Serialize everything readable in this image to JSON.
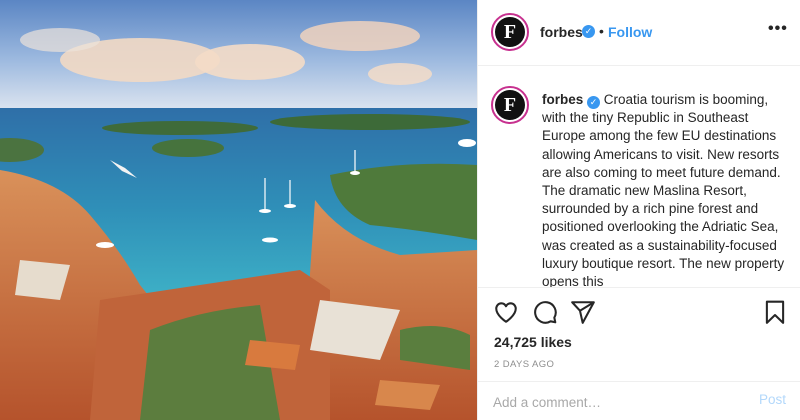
{
  "header": {
    "avatar_letter": "F",
    "username": "forbes",
    "verified_icon": "verified-badge-icon",
    "separator": "•",
    "follow_label": "Follow",
    "more_label": "•••"
  },
  "caption": {
    "avatar_letter": "F",
    "username": "forbes",
    "text": "Croatia tourism is booming, with the tiny Republic in Southeast Europe among the few EU destinations allowing Americans to visit. New resorts are also coming to meet future demand. The dramatic new Maslina Resort, surrounded by a rich pine forest and positioned overlooking the Adriatic Sea, was created as a sustainability-focused luxury boutique resort. The new property opens this"
  },
  "actions": {
    "icons": [
      "heart-icon",
      "comment-icon",
      "share-icon",
      "bookmark-icon"
    ],
    "likes": "24,725 likes",
    "time": "2 DAYS AGO"
  },
  "comment": {
    "placeholder": "Add a comment…",
    "post_label": "Post"
  },
  "colors": {
    "accent": "#3897f0",
    "post_disabled": "#b3d8fb",
    "avatar_ring": "#c7318f",
    "muted": "#8e8e8e",
    "border": "#efefef"
  }
}
